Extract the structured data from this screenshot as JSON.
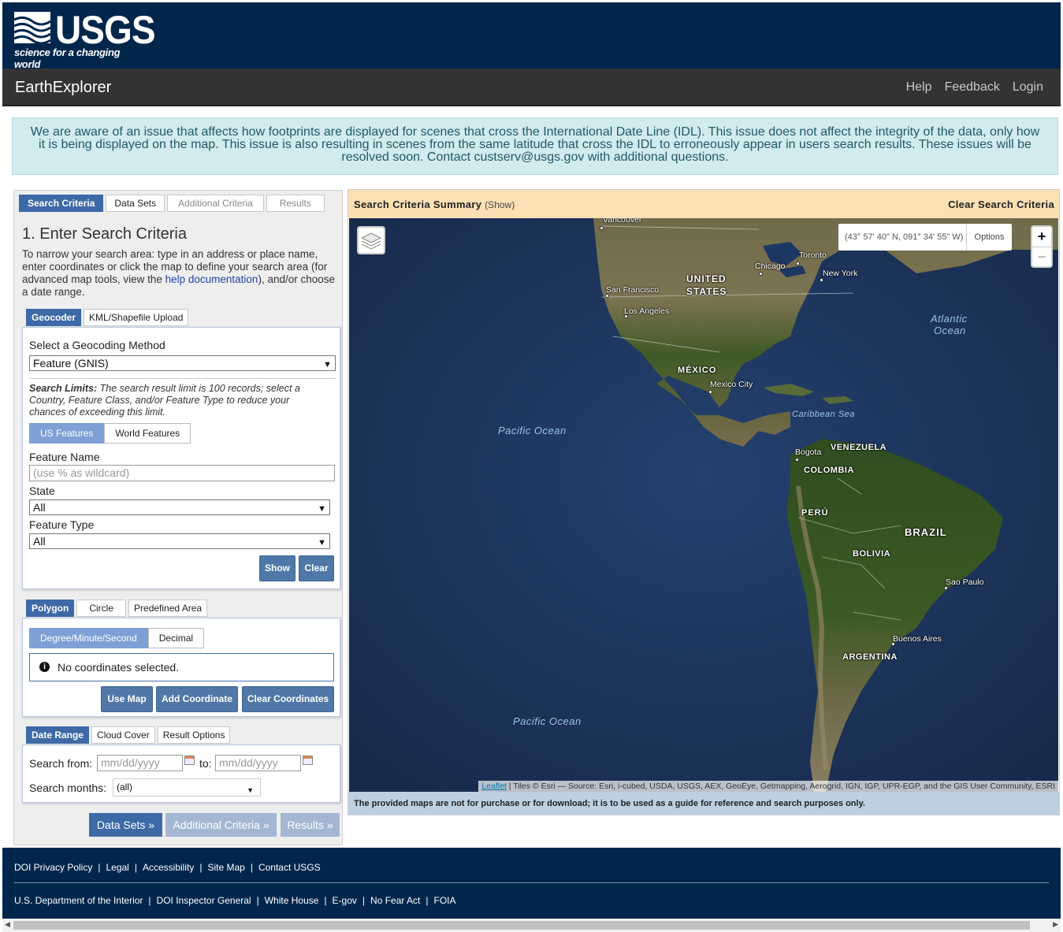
{
  "header": {
    "logo_word": "USGS",
    "logo_tagline": "science for a changing world",
    "app_title": "EarthExplorer",
    "nav": [
      "Help",
      "Feedback",
      "Login"
    ]
  },
  "notice": "We are aware of an issue that affects how footprints are displayed for scenes that cross the International Date Line (IDL). This issue does not affect the integrity of the data, only how it is being displayed on the map. This issue is also resulting in scenes from the same latitude that cross the IDL to erroneously appear in users search results. These issues will be resolved soon. Contact custserv@usgs.gov with additional questions.",
  "main_tabs": [
    "Search Criteria",
    "Data Sets",
    "Additional Criteria",
    "Results"
  ],
  "search": {
    "heading": "1. Enter Search Criteria",
    "intro_before": "To narrow your search area: type in an address or place name, enter coordinates or click the map to define your search area (for advanced map tools, view the ",
    "intro_link": "help documentation",
    "intro_after": "), and/or choose a date range.",
    "geo_tabs": [
      "Geocoder",
      "KML/Shapefile Upload"
    ],
    "method_label": "Select a Geocoding Method",
    "method_value": "Feature (GNIS)",
    "limits_bold": "Search Limits:",
    "limits_text": " The search result limit is 100 records; select a Country, Feature Class, and/or Feature Type to reduce your chances of exceeding this limit.",
    "feature_scope": [
      "US Features",
      "World Features"
    ],
    "feature_name_label": "Feature Name",
    "feature_name_placeholder": "(use % as wildcard)",
    "state_label": "State",
    "state_value": "All",
    "feature_type_label": "Feature Type",
    "feature_type_value": "All",
    "show_btn": "Show",
    "clear_btn": "Clear"
  },
  "area": {
    "tabs": [
      "Polygon",
      "Circle",
      "Predefined Area"
    ],
    "format": [
      "Degree/Minute/Second",
      "Decimal"
    ],
    "no_coords": "No coordinates selected.",
    "use_map": "Use Map",
    "add_coord": "Add Coordinate",
    "clear_coords": "Clear Coordinates"
  },
  "dates": {
    "tabs": [
      "Date Range",
      "Cloud Cover",
      "Result Options"
    ],
    "from_label": "Search from:",
    "from_placeholder": "mm/dd/yyyy",
    "to_label": "to:",
    "to_placeholder": "mm/dd/yyyy",
    "months_label": "Search months:",
    "months_value": "(all)"
  },
  "nav_buttons": [
    "Data Sets »",
    "Additional Criteria »",
    "Results »"
  ],
  "map": {
    "summary_title": "Search Criteria Summary",
    "summary_show": "(Show)",
    "clear_criteria": "Clear Search Criteria",
    "coords": "(43° 57' 40\" N, 091° 34' 55\" W)",
    "options": "Options",
    "zoom_in": "+",
    "zoom_out": "−",
    "attrib_link": "Leaflet",
    "attrib_text": " | Tiles © Esri — Source: Esri, i-cubed, USDA, USGS, AEX, GeoEye, Getmapping, Aerogrid, IGN, IGP, UPR-EGP, and the GIS User Community, ESRI",
    "disclaimer": "The provided maps are not for purchase or for download; it is to be used as a guide for reference and search purposes only.",
    "labels": {
      "vancouver": "Vancouver",
      "toronto": "Toronto",
      "chicago": "Chicago",
      "new_york": "New York",
      "united": "UNITED",
      "states": "STATES",
      "san_francisco": "San Francisco",
      "los_angeles": "Los Angeles",
      "atlantic": "Atlantic",
      "ocean": "Ocean",
      "mexico": "MÉXICO",
      "mexico_city": "Mexico City",
      "caribbean": "Caribbean Sea",
      "pacific1": "Pacific Ocean",
      "bogota": "Bogota",
      "venezuela": "VENEZUELA",
      "colombia": "COLOMBIA",
      "peru": "PERÚ",
      "brazil": "BRAZIL",
      "bolivia": "BOLIVIA",
      "sao_paulo": "Sao Paulo",
      "buenos_aires": "Buenos Aires",
      "argentina": "ARGENTINA",
      "pacific2": "Pacific Ocean"
    }
  },
  "footer": {
    "row1": [
      "DOI Privacy Policy",
      "Legal",
      "Accessibility",
      "Site Map",
      "Contact USGS"
    ],
    "row2": [
      "U.S. Department of the Interior",
      "DOI Inspector General",
      "White House",
      "E-gov",
      "No Fear Act",
      "FOIA"
    ]
  },
  "colors": {
    "header": "#00264c",
    "app_bar": "#333333",
    "accent": "#3d6aa6",
    "notice_bg": "#d1ebee",
    "summary_bg": "#fbe0b4"
  }
}
